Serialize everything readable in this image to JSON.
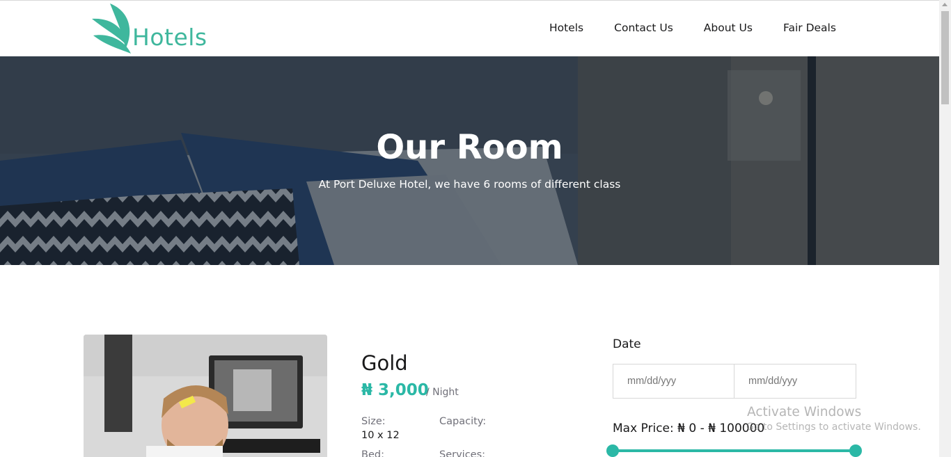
{
  "brand": {
    "logo_text": "Hotels",
    "logo_color": "#3fb79d"
  },
  "nav": {
    "items": [
      "Hotels",
      "Contact Us",
      "About Us",
      "Fair Deals"
    ]
  },
  "hero": {
    "title": "Our Room",
    "subtitle": "At Port Deluxe Hotel, we have 6 rooms of different class"
  },
  "room": {
    "name": "Gold",
    "price": "₦ 3,000",
    "per": "/ Night",
    "specs": {
      "size_label": "Size:",
      "size_value": "10 x 12",
      "capacity_label": "Capacity:",
      "bed_label": "Bed:",
      "services_label": "Services:"
    }
  },
  "filter": {
    "date_label": "Date",
    "check_in_placeholder": "mm/dd/yyy",
    "check_out_placeholder": "mm/dd/yyy",
    "max_price_label": "Max Price: ₦ 0 - ₦ 100000",
    "price_range": {
      "min": 0,
      "max": 100000,
      "low": 0,
      "high": 100000
    },
    "accent": "#2bb8a6"
  },
  "watermark": {
    "title": "Activate Windows",
    "subtitle": "Go to Settings to activate Windows."
  }
}
